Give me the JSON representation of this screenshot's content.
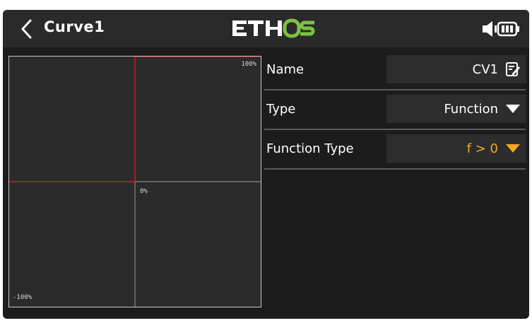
{
  "header": {
    "title": "Curve1",
    "logo_text": "ETHOS",
    "back_icon": "chevron-left-icon",
    "status_icons": [
      "speaker-icon",
      "battery-icon"
    ]
  },
  "graph": {
    "label_top": "100%",
    "label_mid": "0%",
    "label_bottom": "-100%",
    "curve_color": "#c81e1e"
  },
  "form": {
    "name": {
      "label": "Name",
      "value": "CV1",
      "icon": "edit-icon"
    },
    "type": {
      "label": "Type",
      "value": "Function",
      "icon": "dropdown-arrow-icon"
    },
    "function_type": {
      "label": "Function Type",
      "value": "f > 0",
      "icon": "dropdown-arrow-icon"
    }
  },
  "colors": {
    "accent": "#f5a623",
    "logo_green": "#7cc242",
    "background": "#1c1c1c"
  }
}
